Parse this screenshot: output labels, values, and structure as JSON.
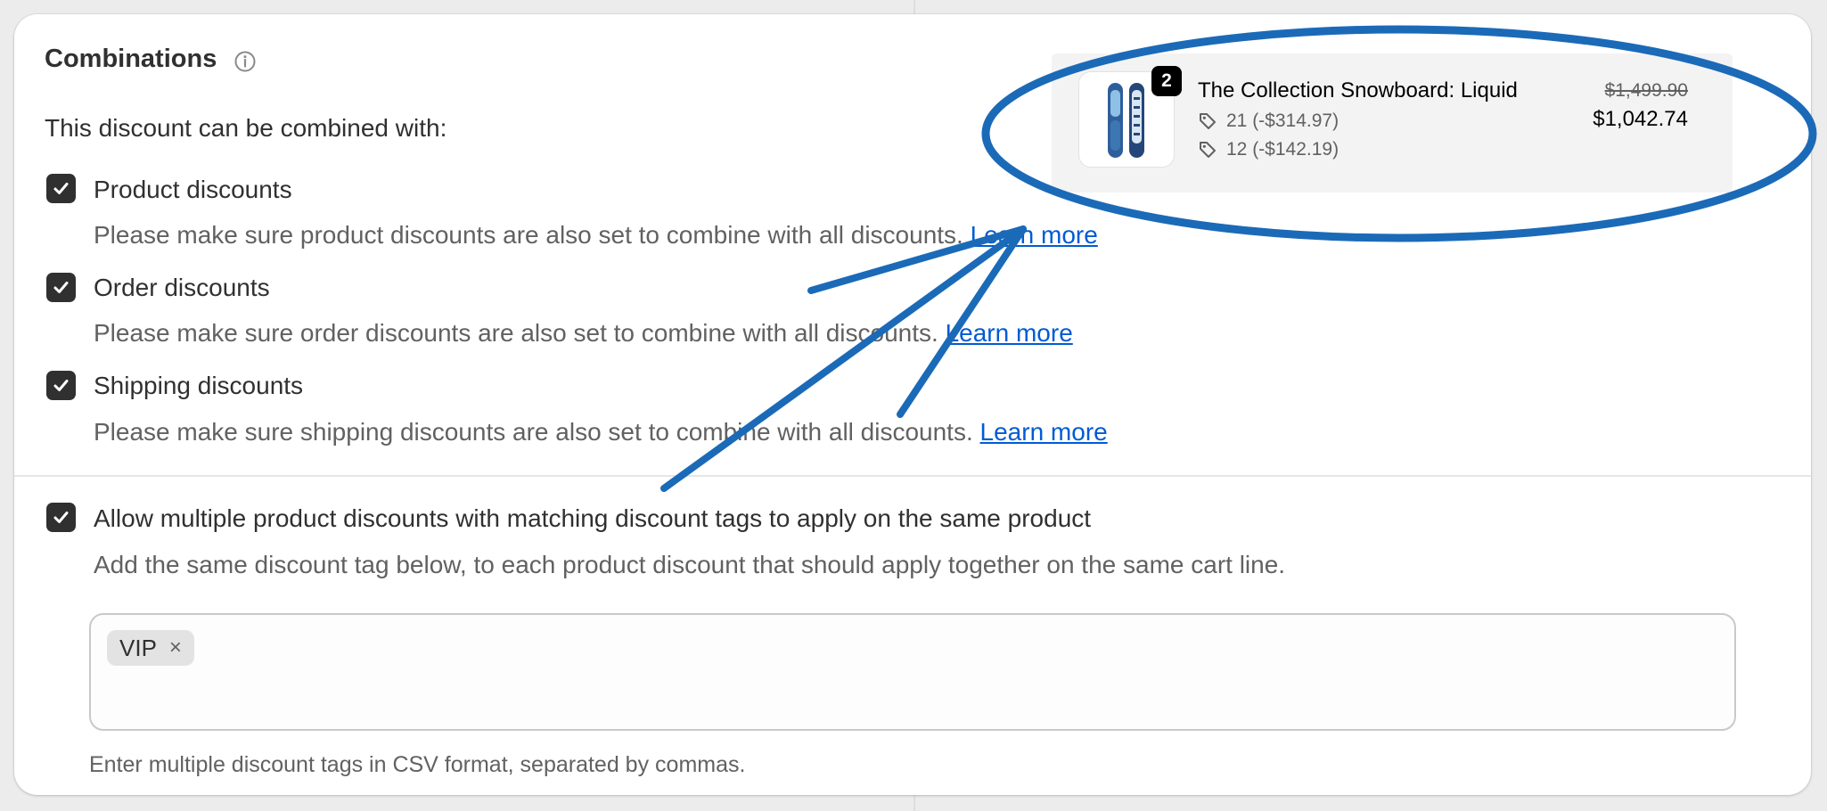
{
  "section": {
    "title": "Combinations",
    "subtitle": "This discount can be combined with:"
  },
  "options": [
    {
      "label": "Product discounts",
      "help": "Please make sure product discounts are also set to combine with all discounts.",
      "link": "Learn more",
      "checked": true
    },
    {
      "label": "Order discounts",
      "help": "Please make sure order discounts are also set to combine with all discounts.",
      "link": "Learn more",
      "checked": true
    },
    {
      "label": "Shipping discounts",
      "help": "Please make sure shipping discounts are also set to combine with all discounts.",
      "link": "Learn more",
      "checked": true
    }
  ],
  "multi_tag": {
    "label": "Allow multiple product discounts with matching discount tags to apply on the same product",
    "help": "Add the same discount tag below, to each product discount that should apply together on the same cart line.",
    "checked": true,
    "tags": [
      "VIP"
    ],
    "remove_symbol": "×",
    "hint": "Enter multiple discount tags in CSV format, separated by commas."
  },
  "cart_item": {
    "quantity": "2",
    "title": "The Collection Snowboard: Liquid",
    "discounts": [
      "21 (-$314.97)",
      "12 (-$142.19)"
    ],
    "original_price": "$1,499.90",
    "final_price": "$1,042.74"
  },
  "colors": {
    "accent_link": "#005bd3",
    "annotation_blue": "#1b6ab8",
    "checkbox": "#303030"
  },
  "icons": {
    "info": "info-icon",
    "check": "checkmark-icon",
    "tag": "tag-icon",
    "remove": "close-icon"
  }
}
